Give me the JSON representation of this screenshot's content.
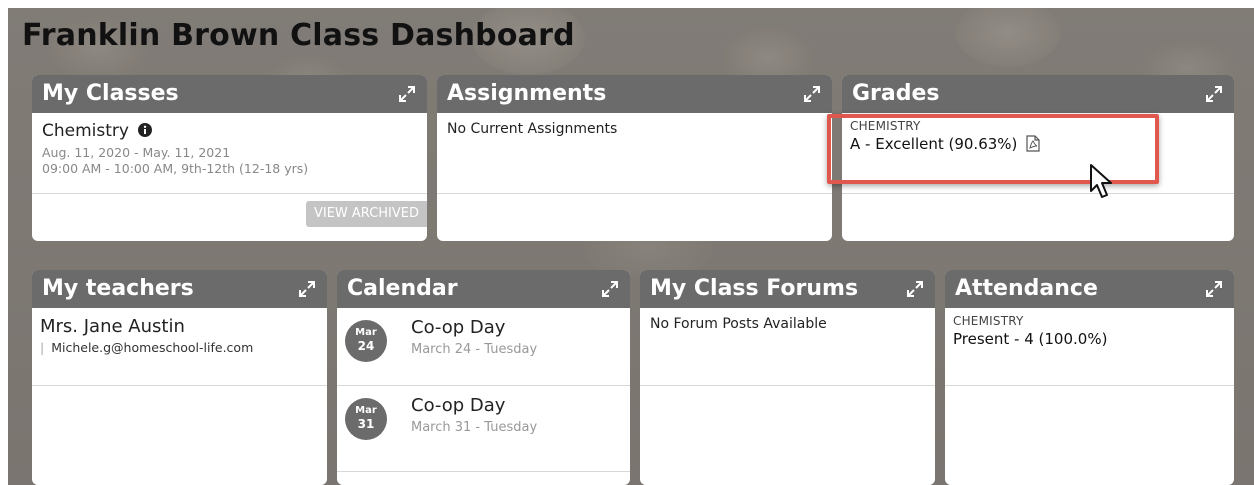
{
  "page": {
    "title": "Franklin Brown Class Dashboard"
  },
  "colors": {
    "header_bg": "#6b6b6b",
    "highlight": "#e0584d",
    "badge_bg": "#6b6b6b"
  },
  "my_classes": {
    "title": "My Classes",
    "class_name": "Chemistry",
    "dates": "Aug. 11, 2020 - May. 11, 2021",
    "schedule": "09:00 AM - 10:00 AM, 9th-12th (12-18 yrs)",
    "view_archived_label": "VIEW ARCHIVED",
    "info_icon": "info-circle-icon",
    "expand_icon": "expand-icon"
  },
  "assignments": {
    "title": "Assignments",
    "empty_text": "No Current Assignments"
  },
  "grades": {
    "title": "Grades",
    "subject": "CHEMISTRY",
    "grade": "A - Excellent (90.63%)",
    "pdf_icon": "pdf-icon"
  },
  "my_teachers": {
    "title": "My teachers",
    "teacher_name": "Mrs. Jane Austin",
    "separator": "|",
    "teacher_email": "Michele.g@homeschool-life.com"
  },
  "calendar": {
    "title": "Calendar",
    "events": [
      {
        "month": "Mar",
        "day": "24",
        "title": "Co-op Day",
        "subtitle": "March 24 - Tuesday"
      },
      {
        "month": "Mar",
        "day": "31",
        "title": "Co-op Day",
        "subtitle": "March 31 - Tuesday"
      }
    ]
  },
  "forums": {
    "title": "My Class Forums",
    "empty_text": "No Forum Posts Available"
  },
  "attendance": {
    "title": "Attendance",
    "subject": "CHEMISTRY",
    "value": "Present - 4 (100.0%)"
  }
}
